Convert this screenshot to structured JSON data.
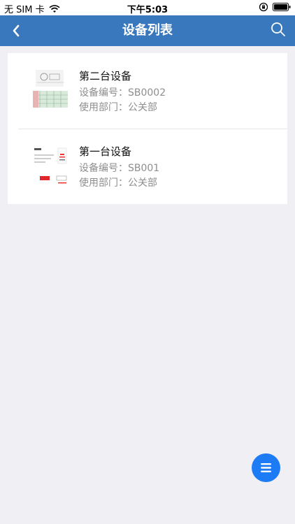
{
  "status_bar": {
    "carrier": "无 SIM 卡",
    "time": "下午5:03"
  },
  "nav": {
    "title": "设备列表",
    "back_icon": "chevron-left-icon",
    "search_icon": "search-icon"
  },
  "devices": [
    {
      "name": "第二台设备",
      "code_label": "设备编号：",
      "code": "SB0002",
      "dept_label": "使用部门：",
      "dept": "公关部",
      "thumbnail_icon": "device-thumbnail"
    },
    {
      "name": "第一台设备",
      "code_label": "设备编号：",
      "code": "SB001",
      "dept_label": "使用部门：",
      "dept": "公关部",
      "thumbnail_icon": "device-thumbnail"
    }
  ],
  "colors": {
    "nav": "#3a78bd",
    "fab": "#1d7bf5",
    "background": "#efeff4"
  },
  "fab": {
    "icon": "menu-icon"
  }
}
